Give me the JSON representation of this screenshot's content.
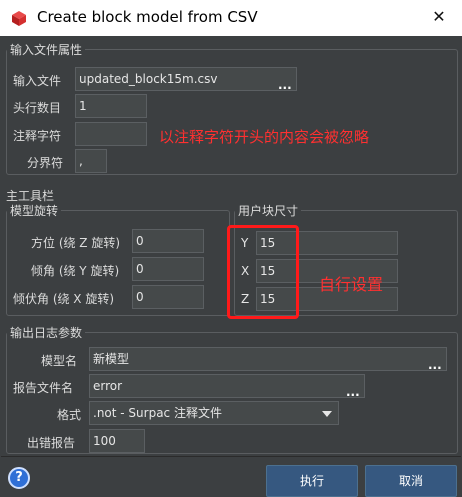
{
  "window": {
    "title": "Create block model from CSV",
    "close_glyph": "✕"
  },
  "input_props": {
    "legend": "输入文件属性",
    "input_file_label": "输入文件",
    "input_file_value": "updated_block15m.csv",
    "header_rows_label": "头行数目",
    "header_rows_value": "1",
    "comment_char_label": "注释字符",
    "comment_char_value": "",
    "delimiter_label": "分界符",
    "delimiter_value": ","
  },
  "annotations": {
    "comment_note": "以注释字符开头的内容会被忽略",
    "block_note": "自行设置"
  },
  "main_toolbar": {
    "label": "主工具栏"
  },
  "rotation": {
    "legend": "模型旋转",
    "azimuth_label": "方位 (绕 Z 旋转)",
    "azimuth_value": "0",
    "dip_label": "倾角 (绕 Y 旋转)",
    "dip_value": "0",
    "plunge_label": "倾伏角 (绕 X 旋转)",
    "plunge_value": "0"
  },
  "block_size": {
    "legend": "用户块尺寸",
    "y_label": "Y",
    "y_value": "15",
    "x_label": "X",
    "x_value": "15",
    "z_label": "Z",
    "z_value": "15"
  },
  "output_log": {
    "legend": "输出日志参数",
    "model_name_label": "模型名",
    "model_name_value": "新模型",
    "report_name_label": "报告文件名",
    "report_name_value": "error",
    "format_label": "格式",
    "format_value": ".not - Surpac 注释文件",
    "error_report_label": "出错报告",
    "error_report_value": "100"
  },
  "buttons": {
    "execute": "执行",
    "cancel": "取消",
    "help": "?"
  },
  "browse_glyph": "...",
  "colors": {
    "accent": "#365880",
    "highlight": "#ff1a1a",
    "background": "#3c3f41"
  }
}
